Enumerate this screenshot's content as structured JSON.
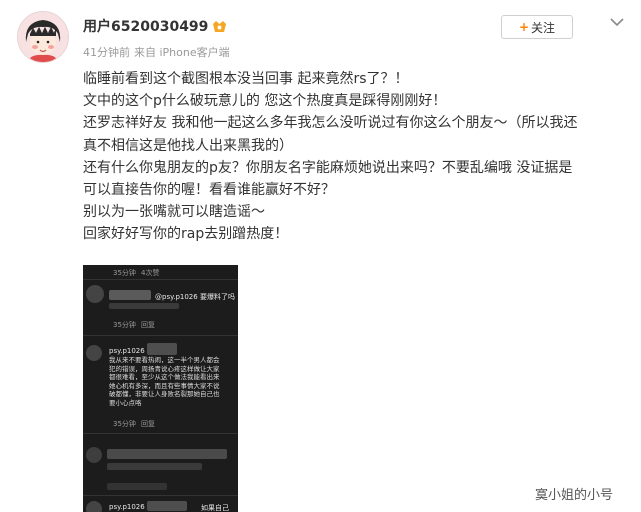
{
  "post": {
    "username": "用户6520030499",
    "time": "41分钟前",
    "source": "来自 iPhone客户端",
    "follow_label": "关注",
    "follow_plus": "+",
    "lines": [
      "临睡前看到这个截图根本没当回事 起来竟然rs了？！",
      "文中的这个p什么破玩意儿的 您这个热度真是踩得刚刚好！",
      "还罗志祥好友 我和他一起这么多年我怎么没听说过有你这么个朋友～（所以我还",
      "真不相信这是他找人出来黑我的）",
      "还有什么你鬼朋友的p友？你朋友名字能麻烦她说出来吗？不要乱编哦 没证据是",
      "可以直接告你的喔！看看谁能赢好不好？",
      "别以为一张嘴就可以瞎造谣～",
      "回家好好写你的rap去别蹭热度！"
    ]
  },
  "screenshot": {
    "top_meta": [
      "35分钟",
      "4次赞"
    ],
    "comment1": "@psy.p1026 要爆料了吗",
    "comment1_meta": [
      "35分钟",
      "回复"
    ],
    "comment2_user": "psy.p1026",
    "comment2_text": "我从来不要看热闹，这一半个男人都会犯的错误，周扬青说心疼这样做让大家都很难看，至少从这个做法我能看出来她心机有多深，而且有些事情大家不说破都懂，非要让人身败名裂那她自己也要小心点咯",
    "comment2_meta": [
      "35分钟",
      "回复"
    ],
    "comment3_user": "psy.p1026",
    "comment3_tail": "如果自己"
  },
  "watermark": "寞小姐的小号",
  "icons": {
    "avatar": "cartoon-girl-avatar",
    "verified": "vip-badge-icon",
    "more": "chevron-down-icon"
  },
  "colors": {
    "accent": "#ff8200",
    "meta": "#9a9a9a",
    "text": "#333333",
    "screenshot_bg": "#1c1c1c"
  }
}
